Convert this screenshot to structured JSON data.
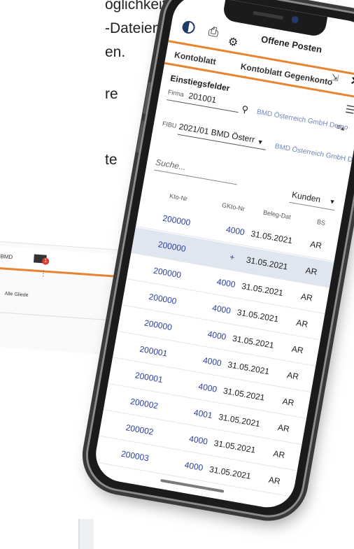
{
  "background_text": {
    "line1": "öglichkeit,",
    "line2": "-Dateien",
    "line3": "en.",
    "line4": "re",
    "line5": "te"
  },
  "desktop": {
    "brand": "BMD",
    "badge": "1",
    "menu_dots": "⋮",
    "filter_label": "Alle Gliede"
  },
  "app": {
    "title": "Offene Posten",
    "tabs": [
      "Kontoblatt",
      "Kontoblatt Gegenkonto"
    ],
    "section": "Einstiegsfelder",
    "firma": {
      "label": "Firma",
      "value": "201001",
      "company": "BMD Österreich GmbH Demo"
    },
    "fibu": {
      "label": "FIBU",
      "value": "2021/01 BMD Österr",
      "company": "BMD Österreich GmbH De"
    },
    "search_placeholder": "Suche...",
    "customer_filter": "Kunden",
    "table": {
      "headers": [
        "Kto-Nr",
        "GKto-Nr",
        "Beleg-Dat",
        "BS"
      ],
      "rows": [
        {
          "kto": "200000",
          "gkto": "4000",
          "date": "31.05.2021",
          "bs": "AR",
          "highlight": false
        },
        {
          "kto": "200000",
          "gkto": "+",
          "date": "31.05.2021",
          "bs": "AR",
          "highlight": true
        },
        {
          "kto": "200000",
          "gkto": "4000",
          "date": "31.05.2021",
          "bs": "AR",
          "highlight": false
        },
        {
          "kto": "200000",
          "gkto": "4000",
          "date": "31.05.2021",
          "bs": "AR",
          "highlight": false
        },
        {
          "kto": "200000",
          "gkto": "4000",
          "date": "31.05.2021",
          "bs": "AR",
          "highlight": false
        },
        {
          "kto": "200001",
          "gkto": "4000",
          "date": "31.05.2021",
          "bs": "AR",
          "highlight": false
        },
        {
          "kto": "200001",
          "gkto": "4000",
          "date": "31.05.2021",
          "bs": "AR",
          "highlight": false
        },
        {
          "kto": "200002",
          "gkto": "4001",
          "date": "31.05.2021",
          "bs": "AR",
          "highlight": false
        },
        {
          "kto": "200002",
          "gkto": "4000",
          "date": "31.05.2021",
          "bs": "AR",
          "highlight": false
        },
        {
          "kto": "200003",
          "gkto": "4000",
          "date": "31.05.2021",
          "bs": "AR",
          "highlight": false
        }
      ]
    }
  },
  "colors": {
    "accent": "#e8832f",
    "link": "#2b3f9e",
    "highlight_row": "#dfe6f0"
  },
  "icons": [
    "contrast-icon",
    "print-icon",
    "gear-icon",
    "collapse-icon",
    "close-icon",
    "menu-icon",
    "search-icon",
    "list-icon",
    "mail-icon"
  ]
}
